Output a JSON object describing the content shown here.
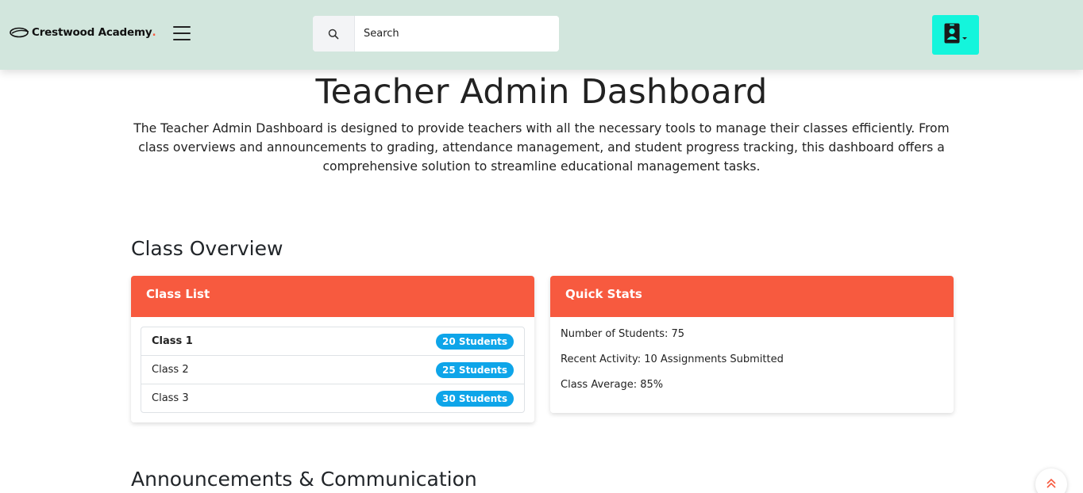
{
  "header": {
    "logo_text": "Crestwood Academy",
    "logo_dot": ".",
    "search_placeholder": "Search",
    "menu_icon": "hamburger-menu-icon",
    "profile_icon": "user-contact-icon",
    "accent": "#14f5dc",
    "bar_color": "#d2e6dd"
  },
  "hero": {
    "title": "Teacher Admin Dashboard",
    "description": "The Teacher Admin Dashboard is designed to provide teachers with all the necessary tools to manage their classes efficiently. From class overviews and announcements to grading, attendance management, and student progress tracking, this dashboard offers a comprehensive solution to streamline educational management tasks."
  },
  "class_overview": {
    "title": "Class Overview",
    "class_list": {
      "header": "Class List",
      "items": [
        {
          "name": "Class 1",
          "badge": "20 Students"
        },
        {
          "name": "Class 2",
          "badge": "25 Students"
        },
        {
          "name": "Class 3",
          "badge": "30 Students"
        }
      ]
    },
    "quick_stats": {
      "header": "Quick Stats",
      "items": [
        "Number of Students: 75",
        "Recent Activity: 10 Assignments Submitted",
        "Class Average: 85%"
      ]
    },
    "header_color": "#f75a3f",
    "badge_color": "#0ea5e9"
  },
  "announcements": {
    "title": "Announcements & Communication"
  }
}
